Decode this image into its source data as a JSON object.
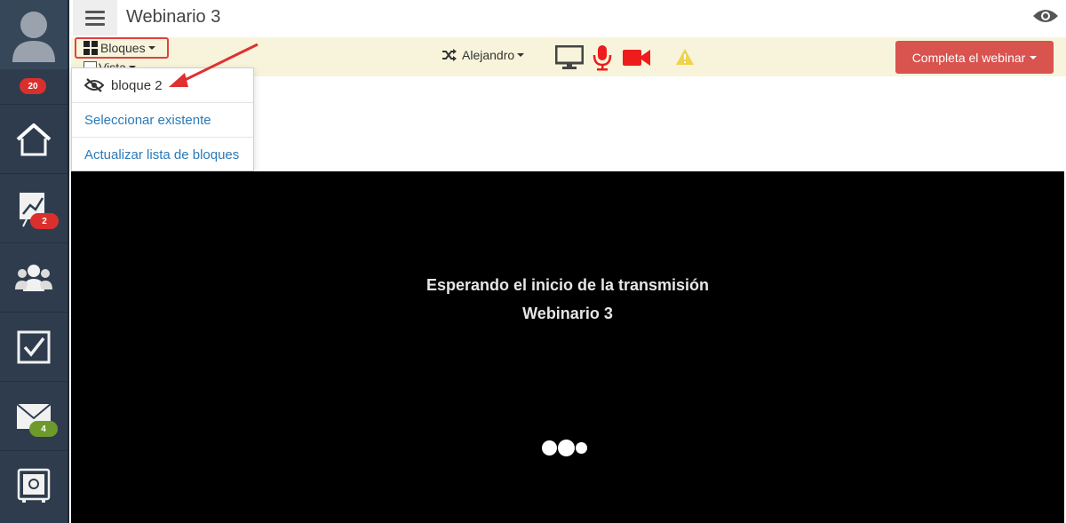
{
  "sidebar": {
    "badges": {
      "profile": "20",
      "stats": "2",
      "mail": "4"
    },
    "items": [
      {
        "icon": "home-icon"
      },
      {
        "icon": "chart-icon"
      },
      {
        "icon": "users-icon"
      },
      {
        "icon": "tasks-icon"
      },
      {
        "icon": "mail-icon"
      },
      {
        "icon": "safe-icon"
      }
    ]
  },
  "header": {
    "title": "Webinario 3"
  },
  "toolbar": {
    "bloques_label": "Bloques",
    "vista_label": "Vista",
    "presenter": "Alejandro",
    "complete_button": "Completa el webinar"
  },
  "dropdown": {
    "items": [
      {
        "label": "bloque 2",
        "icon": "eye-slash-icon"
      },
      {
        "label": "Seleccionar existente"
      },
      {
        "label": "Actualizar lista de bloques"
      }
    ]
  },
  "video": {
    "status_text": "Esperando el inicio de la transmisión",
    "webinar_title": "Webinario 3"
  },
  "colors": {
    "sidebar_bg": "#2f3c4d",
    "toolbar_bg": "#f7f4db",
    "accent_red": "#d9534f",
    "link_blue": "#2a7ab8",
    "media_red": "#ee1c1c"
  }
}
